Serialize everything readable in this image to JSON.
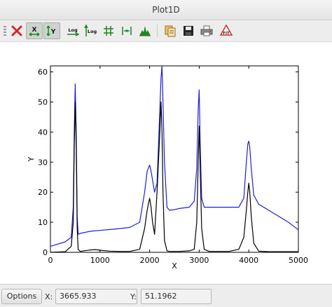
{
  "window": {
    "title": "Plot1D"
  },
  "toolbar": {
    "buttons": [
      {
        "id": "clear",
        "icon": "red-x-icon"
      },
      {
        "id": "autoscale-x",
        "icon": "autoscale-x-icon",
        "label": "X",
        "active": true
      },
      {
        "id": "autoscale-y",
        "icon": "autoscale-y-icon",
        "label": "Y",
        "active": true
      },
      {
        "id": "log-x",
        "icon": "log-x-icon",
        "label": "Log"
      },
      {
        "id": "log-y",
        "icon": "log-y-icon",
        "label": "Log"
      },
      {
        "id": "grid",
        "icon": "grid-icon"
      },
      {
        "id": "curve-style",
        "icon": "curve-style-icon"
      },
      {
        "id": "histogram",
        "icon": "histogram-icon"
      },
      {
        "id": "copy",
        "icon": "copy-icon"
      },
      {
        "id": "save",
        "icon": "save-icon"
      },
      {
        "id": "print",
        "icon": "print-icon"
      },
      {
        "id": "fit",
        "icon": "fit-icon",
        "label": "FIT"
      }
    ]
  },
  "chart_data": {
    "type": "line",
    "xlabel": "X",
    "ylabel": "Y",
    "xlim": [
      0,
      5000
    ],
    "ylim": [
      0,
      62
    ],
    "xticks": [
      0,
      1000,
      2000,
      3000,
      4000,
      5000
    ],
    "yticks": [
      0,
      10,
      20,
      30,
      40,
      50,
      60
    ],
    "grid": false,
    "series": [
      {
        "color": "#1f1fd6",
        "x": [
          0,
          300,
          420,
          460,
          480,
          500,
          520,
          540,
          560,
          600,
          800,
          1000,
          1200,
          1400,
          1600,
          1800,
          1900,
          1950,
          2000,
          2030,
          2060,
          2100,
          2150,
          2200,
          2230,
          2250,
          2270,
          2300,
          2350,
          2400,
          2500,
          2600,
          2800,
          2900,
          2950,
          2980,
          3000,
          3020,
          3050,
          3100,
          3200,
          3400,
          3600,
          3800,
          3900,
          3950,
          3980,
          4000,
          4020,
          4050,
          4100,
          4200,
          4400,
          4600,
          4800,
          5000
        ],
        "y": [
          2,
          3.5,
          5,
          15,
          40,
          56,
          40,
          12,
          6,
          6.3,
          7,
          7.3,
          7.6,
          7.9,
          8.3,
          10,
          20,
          27,
          29,
          27,
          24,
          20,
          23,
          45,
          58,
          62,
          50,
          30,
          15,
          14,
          14.2,
          14.6,
          15,
          17,
          28,
          48,
          54,
          36,
          18,
          15,
          15,
          15,
          15,
          15,
          18,
          30,
          36,
          37,
          35,
          28,
          19,
          16,
          14,
          12,
          10,
          7.5
        ]
      },
      {
        "color": "#000000",
        "x": [
          0,
          300,
          420,
          460,
          480,
          500,
          520,
          540,
          560,
          600,
          800,
          900,
          1000,
          1200,
          1400,
          1600,
          1800,
          1900,
          1950,
          2000,
          2030,
          2060,
          2100,
          2150,
          2200,
          2230,
          2250,
          2270,
          2300,
          2350,
          2400,
          2500,
          2600,
          2800,
          2900,
          2950,
          2980,
          3000,
          3020,
          3050,
          3100,
          3200,
          3400,
          3600,
          3800,
          3900,
          3950,
          3980,
          4000,
          4020,
          4050,
          4100,
          4200,
          4400,
          4600,
          4800,
          5000
        ],
        "y": [
          0,
          0.2,
          2,
          10,
          35,
          50,
          35,
          8,
          1,
          0.3,
          0.8,
          0.9,
          0.7,
          0.4,
          0.3,
          0.3,
          1,
          8,
          14,
          18,
          15,
          10,
          6,
          20,
          38,
          50,
          40,
          20,
          4,
          0.5,
          0.3,
          0.3,
          0.3,
          0.5,
          1,
          10,
          30,
          42,
          28,
          8,
          1,
          0.3,
          0.3,
          0.3,
          1,
          5,
          14,
          20,
          23,
          20,
          12,
          3,
          0.4,
          0.2,
          0.2,
          0.2,
          0.2
        ]
      }
    ]
  },
  "status": {
    "options_label": "Options",
    "x_label": "X:",
    "x_value": "3665.933",
    "y_label": "Y:",
    "y_value": "51.1962"
  }
}
